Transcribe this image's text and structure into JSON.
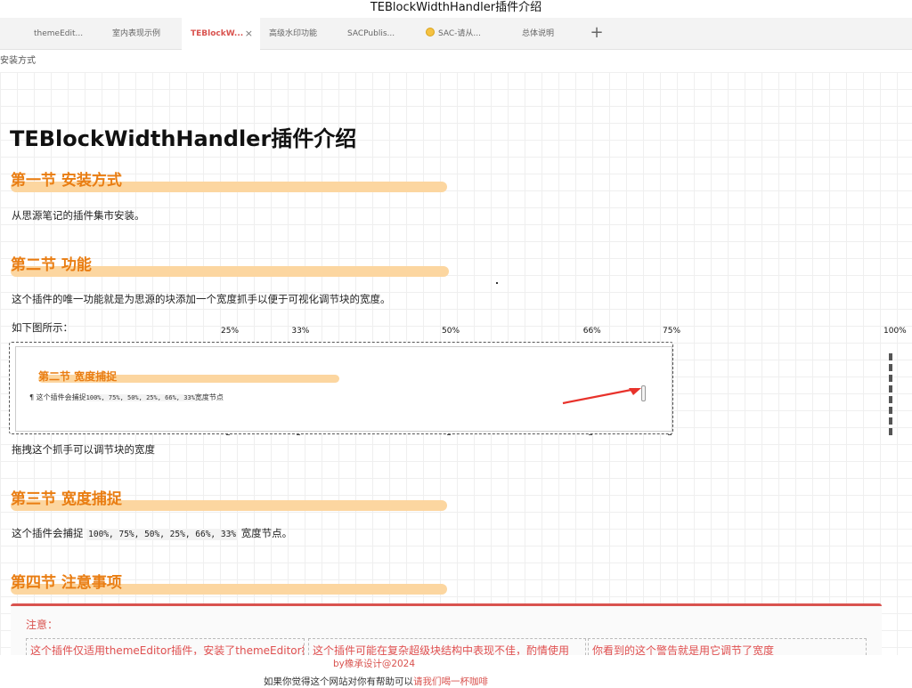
{
  "window": {
    "title": "TEBlockWidthHandler插件介绍"
  },
  "tabs": [
    {
      "label": "themeEdit...",
      "active": false,
      "closable": false,
      "emoji": false
    },
    {
      "label": "室内表现示例",
      "active": false,
      "closable": false,
      "emoji": false
    },
    {
      "label": "TEBlockW...",
      "active": true,
      "closable": true,
      "emoji": false
    },
    {
      "label": "高级水印功能",
      "active": false,
      "closable": false,
      "emoji": false
    },
    {
      "label": "SACPublis...",
      "active": false,
      "closable": false,
      "emoji": false
    },
    {
      "label": "SAC-请从...",
      "active": false,
      "closable": false,
      "emoji": true
    },
    {
      "label": "总体说明",
      "active": false,
      "closable": false,
      "emoji": false
    }
  ],
  "tab_close_glyph": "×",
  "tab_add_glyph": "+",
  "breadcrumb": {
    "text": "安装方式"
  },
  "doc": {
    "title": "TEBlockWidthHandler插件介绍",
    "sections": [
      {
        "heading": "第一节  安装方式"
      },
      {
        "heading": "第二节  功能"
      },
      {
        "heading": "第三节  宽度捕捉"
      },
      {
        "heading": "第四节  注意事项"
      }
    ],
    "p_install": "从思源笔记的插件集市安装。",
    "p_function": "这个插件的唯一功能就是为思源的块添加一个宽度抓手以便于可视化调节块的宽度。",
    "p_figure": "如下图所示：",
    "p_drag": "拖拽这个抓手可以调节块的宽度",
    "p_snap_prefix": "这个插件会捕捉",
    "p_snap_code": "100%, 75%, 50%, 25%, 66%, 33%",
    "p_snap_suffix": "宽度节点。",
    "demo": {
      "heading": "第二节  宽度捕捉",
      "text_prefix": "¶  这个插件会捕捉",
      "text_code": "100%, 75%, 50%, 25%, 66%, 33%",
      "text_suffix": "宽度节点"
    },
    "width_markers": [
      {
        "label": "25%",
        "value": 25
      },
      {
        "label": "33%",
        "value": 33
      },
      {
        "label": "50%",
        "value": 50
      },
      {
        "label": "66%",
        "value": 66
      },
      {
        "label": "75%",
        "value": 75
      },
      {
        "label": "100%",
        "value": 100
      }
    ],
    "notice": {
      "title": "注意：",
      "items": [
        "这个插件仅适用themeEditor插件，安装了themeEditor插",
        "这个插件可能在复杂超级块结构中表现不佳，酌情使用",
        "你看到的这个警告就是用它调节了宽度"
      ]
    }
  },
  "footer": {
    "credit": "by橡承设计@2024",
    "support_prefix": "如果你觉得这个网站对你有帮助可以",
    "support_link": "请我们喝一杯咖啡"
  },
  "colors": {
    "accent_orange": "#e97d12",
    "heading_bar": "#fcd6a0",
    "notice_red": "#d9534f",
    "arrow_red": "#e8322b"
  }
}
